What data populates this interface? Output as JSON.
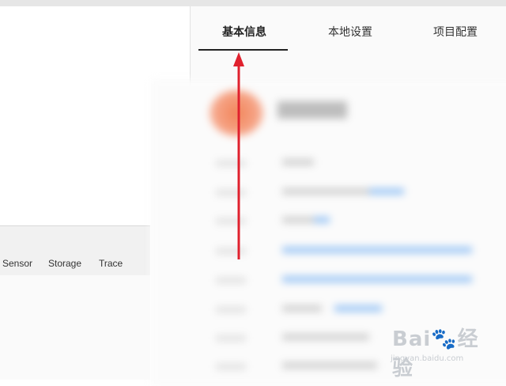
{
  "panel": {
    "tabs": [
      {
        "label": "基本信息",
        "active": true
      },
      {
        "label": "本地设置",
        "active": false
      },
      {
        "label": "项目配置",
        "active": false
      }
    ]
  },
  "devtools": {
    "tabs": [
      "Sensor",
      "Storage",
      "Trace"
    ]
  },
  "watermark": {
    "logo": "Bai🐾经验",
    "url": "jingyan.baidu.com"
  },
  "colors": {
    "arrow": "#e0212e",
    "active_underline": "#222222"
  }
}
